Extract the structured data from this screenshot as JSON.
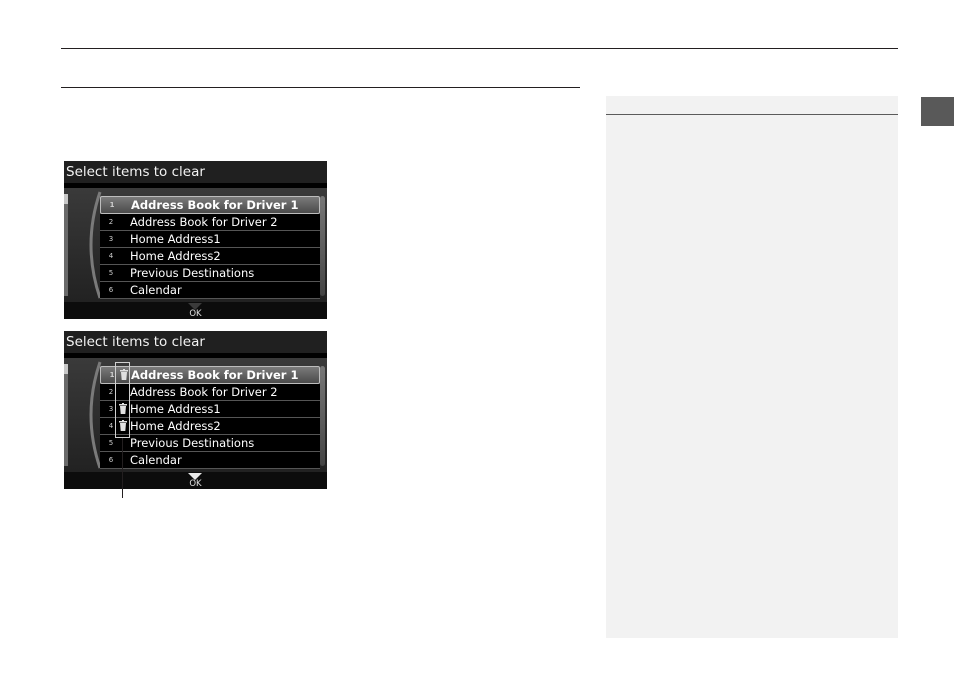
{
  "screens": [
    {
      "title": "Select items to clear",
      "ok_label": "OK",
      "items": [
        {
          "num": "1",
          "label": "Address Book for Driver 1",
          "selected": true,
          "marked": false
        },
        {
          "num": "2",
          "label": "Address Book for Driver 2",
          "selected": false,
          "marked": false
        },
        {
          "num": "3",
          "label": "Home Address1",
          "selected": false,
          "marked": false
        },
        {
          "num": "4",
          "label": "Home Address2",
          "selected": false,
          "marked": false
        },
        {
          "num": "5",
          "label": "Previous Destinations",
          "selected": false,
          "marked": false
        },
        {
          "num": "6",
          "label": "Calendar",
          "selected": false,
          "marked": false
        }
      ]
    },
    {
      "title": "Select items to clear",
      "ok_label": "OK",
      "items": [
        {
          "num": "1",
          "label": "Address Book for Driver 1",
          "selected": true,
          "marked": true
        },
        {
          "num": "2",
          "label": "Address Book for Driver 2",
          "selected": false,
          "marked": false
        },
        {
          "num": "3",
          "label": "Home Address1",
          "selected": false,
          "marked": true
        },
        {
          "num": "4",
          "label": "Home Address2",
          "selected": false,
          "marked": true
        },
        {
          "num": "5",
          "label": "Previous Destinations",
          "selected": false,
          "marked": false
        },
        {
          "num": "6",
          "label": "Calendar",
          "selected": false,
          "marked": false
        }
      ]
    }
  ],
  "icons": {
    "trash": "trash-icon",
    "ok_arrow": "down-triangle-icon"
  },
  "colors": {
    "accent_tab": "#595959",
    "sidebar_bg": "#f2f2f2",
    "screen_bg": "#000000"
  }
}
